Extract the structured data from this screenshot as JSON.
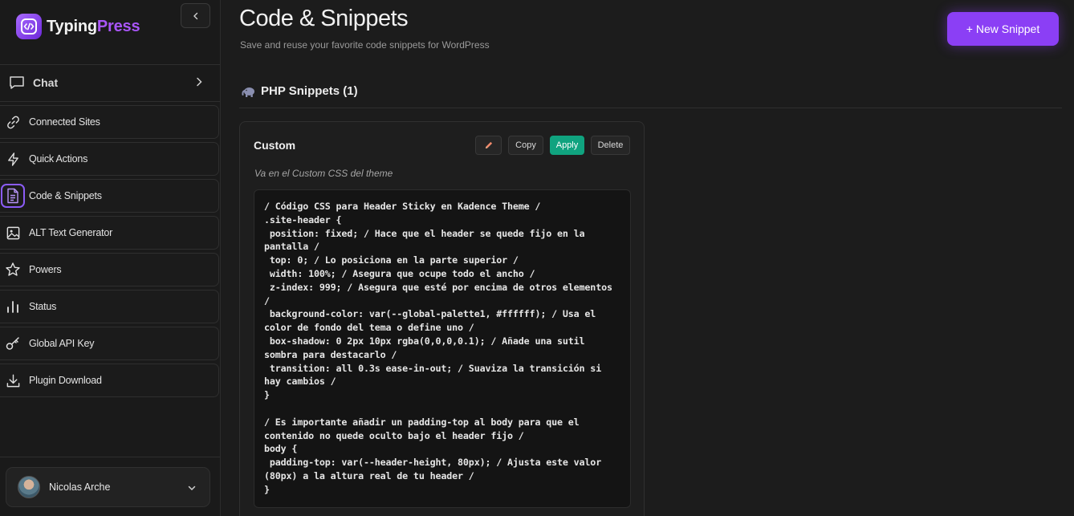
{
  "brand": {
    "name_part1": "Typing",
    "name_part2": "Press"
  },
  "sidebar": {
    "chat_label": "Chat",
    "items": [
      {
        "label": "Connected Sites",
        "icon": "link-icon"
      },
      {
        "label": "Quick Actions",
        "icon": "bolt-icon"
      },
      {
        "label": "Code & Snippets",
        "icon": "document-icon",
        "active": true
      },
      {
        "label": "ALT Text Generator",
        "icon": "image-icon"
      },
      {
        "label": "Powers",
        "icon": "star-icon"
      },
      {
        "label": "Status",
        "icon": "bar-chart-icon"
      },
      {
        "label": "Global API Key",
        "icon": "key-icon"
      },
      {
        "label": "Plugin Download",
        "icon": "download-icon"
      }
    ],
    "user_name": "Nicolas Arche"
  },
  "header": {
    "title": "Code & Snippets",
    "subtitle": "Save and reuse your favorite code snippets for WordPress",
    "new_button": "+ New Snippet"
  },
  "section": {
    "title": "PHP Snippets (1)",
    "icon": "elephant-icon"
  },
  "snippet": {
    "title": "Custom",
    "copy_label": "Copy",
    "apply_label": "Apply",
    "delete_label": "Delete",
    "description": "Va en el Custom CSS del theme",
    "code": "/ Código CSS para Header Sticky en Kadence Theme /\n.site-header {\n position: fixed; / Hace que el header se quede fijo en la pantalla /\n top: 0; / Lo posiciona en la parte superior /\n width: 100%; / Asegura que ocupe todo el ancho /\n z-index: 999; / Asegura que esté por encima de otros elementos /\n background-color: var(--global-palette1, #ffffff); / Usa el color de fondo del tema o define uno /\n box-shadow: 0 2px 10px rgba(0,0,0,0.1); / Añade una sutil sombra para destacarlo /\n transition: all 0.3s ease-in-out; / Suaviza la transición si hay cambios /\n}\n\n/ Es importante añadir un padding-top al body para que el contenido no quede oculto bajo el header fijo /\nbody {\n padding-top: var(--header-height, 80px); / Ajusta este valor (80px) a la altura real de tu header /\n}"
  },
  "colors": {
    "accent": "#8b3ff5",
    "apply": "#10a37f",
    "background": "#1c1c1c"
  }
}
